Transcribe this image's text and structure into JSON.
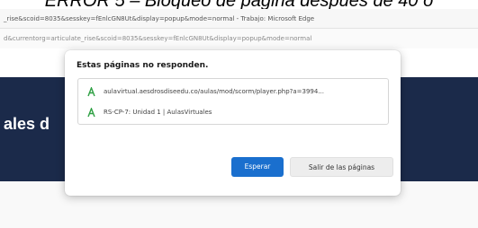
{
  "caption": "ERROR 5 – Bloqueo de página después de 40 o",
  "window": {
    "title": "_rise&scoid=8035&sesskey=fEnlcGN8Ut&display=popup&mode=normal - Trabajo: Microsoft Edge",
    "address": "d&currentorg=articulate_rise&scoid=8035&sesskey=fEnlcGN8Ut&display=popup&mode=normal"
  },
  "page": {
    "heading": "ales d",
    "band_color": "#1b2a4a"
  },
  "dialog": {
    "title": "Estas páginas no responden.",
    "pages": [
      {
        "text": "aulavirtual.aesdrosdiseedu.co/aulas/mod/scorm/player.php?a=3994...",
        "icon": "page-icon"
      },
      {
        "text": "RS-CP-7: Unidad 1 | AulasVirtuales",
        "icon": "page-icon"
      }
    ],
    "wait_label": "Esperar",
    "exit_label": "Salir de las páginas",
    "accent": "#1a6fce",
    "icon_color": "#2ea043"
  }
}
